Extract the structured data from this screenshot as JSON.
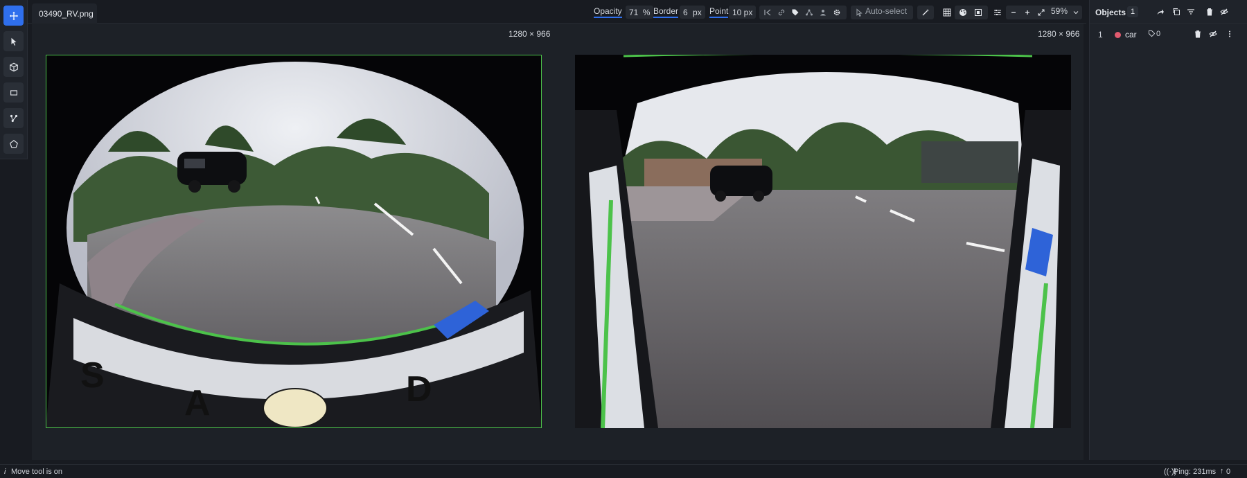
{
  "file": {
    "name": "03490_RV.png"
  },
  "toolbar": {
    "opacity_label": "Opacity",
    "opacity_value": "71",
    "opacity_unit": "%",
    "border_label": "Border",
    "border_value": "6",
    "border_unit": "px",
    "point_label": "Point",
    "point_value": "10 px",
    "auto_select": "Auto-select",
    "zoom": "59%"
  },
  "canvas": {
    "left_dim": "1280 × 966",
    "right_dim": "1280 × 966"
  },
  "objects": {
    "title": "Objects",
    "count": "1",
    "items": [
      {
        "index": "1",
        "label": "car",
        "tag_count": "0",
        "color": "#e05a6e"
      }
    ]
  },
  "status": {
    "info_icon": "i",
    "message": "Move tool is on",
    "ping": "Ping: 231ms",
    "upload": "0"
  },
  "colors": {
    "accent": "#2f6fed",
    "annotation_green": "#4cc24a"
  }
}
